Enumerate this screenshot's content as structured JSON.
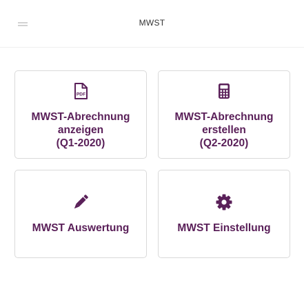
{
  "header": {
    "title": "MWST",
    "menu_icon": "hamburger-menu-icon"
  },
  "tiles": [
    {
      "icon": "pdf-file-icon",
      "label_lines": [
        "MWST-Abrechnung",
        "anzeigen",
        "(Q1-2020)"
      ]
    },
    {
      "icon": "calculator-icon",
      "label_lines": [
        "MWST-Abrechnung",
        "erstellen",
        "(Q2-2020)"
      ]
    },
    {
      "icon": "pencil-icon",
      "label_lines": [
        "MWST Auswertung"
      ]
    },
    {
      "icon": "gear-icon",
      "label_lines": [
        "MWST Einstellung"
      ]
    }
  ],
  "colors": {
    "accent": "#5a2059",
    "menu_icon": "#d2d2d2",
    "border": "#d9d9d9"
  }
}
